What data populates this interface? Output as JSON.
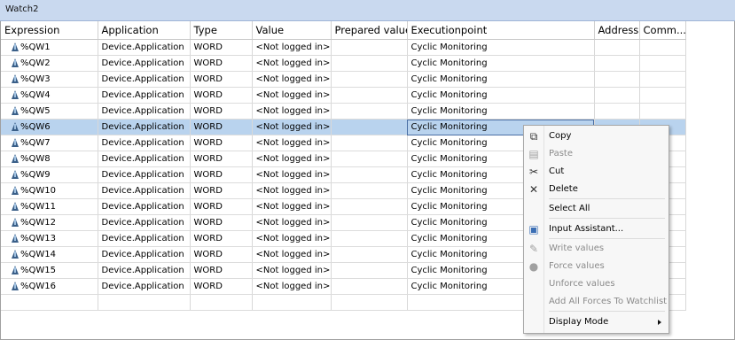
{
  "panel": {
    "title": "Watch2"
  },
  "columns": [
    "Expression",
    "Application",
    "Type",
    "Value",
    "Prepared value",
    "Executionpoint",
    "Address",
    "Comm..."
  ],
  "rows": [
    {
      "expression": "%QW1",
      "application": "Device.Application",
      "type": "WORD",
      "value": "<Not logged in>",
      "prepared": "",
      "exec": "Cyclic Monitoring",
      "address": "",
      "comment": ""
    },
    {
      "expression": "%QW2",
      "application": "Device.Application",
      "type": "WORD",
      "value": "<Not logged in>",
      "prepared": "",
      "exec": "Cyclic Monitoring",
      "address": "",
      "comment": ""
    },
    {
      "expression": "%QW3",
      "application": "Device.Application",
      "type": "WORD",
      "value": "<Not logged in>",
      "prepared": "",
      "exec": "Cyclic Monitoring",
      "address": "",
      "comment": ""
    },
    {
      "expression": "%QW4",
      "application": "Device.Application",
      "type": "WORD",
      "value": "<Not logged in>",
      "prepared": "",
      "exec": "Cyclic Monitoring",
      "address": "",
      "comment": ""
    },
    {
      "expression": "%QW5",
      "application": "Device.Application",
      "type": "WORD",
      "value": "<Not logged in>",
      "prepared": "",
      "exec": "Cyclic Monitoring",
      "address": "",
      "comment": ""
    },
    {
      "expression": "%QW6",
      "application": "Device.Application",
      "type": "WORD",
      "value": "<Not logged in>",
      "prepared": "",
      "exec": "Cyclic Monitoring",
      "address": "",
      "comment": "",
      "selected": true
    },
    {
      "expression": "%QW7",
      "application": "Device.Application",
      "type": "WORD",
      "value": "<Not logged in>",
      "prepared": "",
      "exec": "Cyclic Monitoring",
      "address": "",
      "comment": ""
    },
    {
      "expression": "%QW8",
      "application": "Device.Application",
      "type": "WORD",
      "value": "<Not logged in>",
      "prepared": "",
      "exec": "Cyclic Monitoring",
      "address": "",
      "comment": ""
    },
    {
      "expression": "%QW9",
      "application": "Device.Application",
      "type": "WORD",
      "value": "<Not logged in>",
      "prepared": "",
      "exec": "Cyclic Monitoring",
      "address": "",
      "comment": ""
    },
    {
      "expression": "%QW10",
      "application": "Device.Application",
      "type": "WORD",
      "value": "<Not logged in>",
      "prepared": "",
      "exec": "Cyclic Monitoring",
      "address": "",
      "comment": ""
    },
    {
      "expression": "%QW11",
      "application": "Device.Application",
      "type": "WORD",
      "value": "<Not logged in>",
      "prepared": "",
      "exec": "Cyclic Monitoring",
      "address": "",
      "comment": ""
    },
    {
      "expression": "%QW12",
      "application": "Device.Application",
      "type": "WORD",
      "value": "<Not logged in>",
      "prepared": "",
      "exec": "Cyclic Monitoring",
      "address": "",
      "comment": ""
    },
    {
      "expression": "%QW13",
      "application": "Device.Application",
      "type": "WORD",
      "value": "<Not logged in>",
      "prepared": "",
      "exec": "Cyclic Monitoring",
      "address": "",
      "comment": ""
    },
    {
      "expression": "%QW14",
      "application": "Device.Application",
      "type": "WORD",
      "value": "<Not logged in>",
      "prepared": "",
      "exec": "Cyclic Monitoring",
      "address": "",
      "comment": ""
    },
    {
      "expression": "%QW15",
      "application": "Device.Application",
      "type": "WORD",
      "value": "<Not logged in>",
      "prepared": "",
      "exec": "Cyclic Monitoring",
      "address": "",
      "comment": ""
    },
    {
      "expression": "%QW16",
      "application": "Device.Application",
      "type": "WORD",
      "value": "<Not logged in>",
      "prepared": "",
      "exec": "Cyclic Monitoring",
      "address": "",
      "comment": ""
    },
    {
      "expression": "",
      "application": "",
      "type": "",
      "value": "",
      "prepared": "",
      "exec": "",
      "address": "",
      "comment": ""
    }
  ],
  "context_menu": {
    "items": [
      {
        "label": "Copy",
        "icon": "copy-icon",
        "enabled": true
      },
      {
        "label": "Paste",
        "icon": "paste-icon",
        "enabled": false
      },
      {
        "label": "Cut",
        "icon": "cut-icon",
        "enabled": true
      },
      {
        "label": "Delete",
        "icon": "delete-icon",
        "enabled": true
      },
      {
        "label": "Select All",
        "icon": "",
        "enabled": true
      },
      {
        "label": "Input Assistant...",
        "icon": "input-assistant-icon",
        "enabled": true
      },
      {
        "label": "Write values",
        "icon": "write-values-icon",
        "enabled": false
      },
      {
        "label": "Force values",
        "icon": "force-values-icon",
        "enabled": false
      },
      {
        "label": "Unforce values",
        "icon": "",
        "enabled": false
      },
      {
        "label": "Add All Forces To Watchlist",
        "icon": "",
        "enabled": false
      },
      {
        "label": "Display Mode",
        "icon": "",
        "enabled": true,
        "submenu": true
      }
    ]
  },
  "colors": {
    "selected_row": "#b9d3ee",
    "title_bar": "#c9d9ef",
    "var_icon": "#3a5f88"
  }
}
